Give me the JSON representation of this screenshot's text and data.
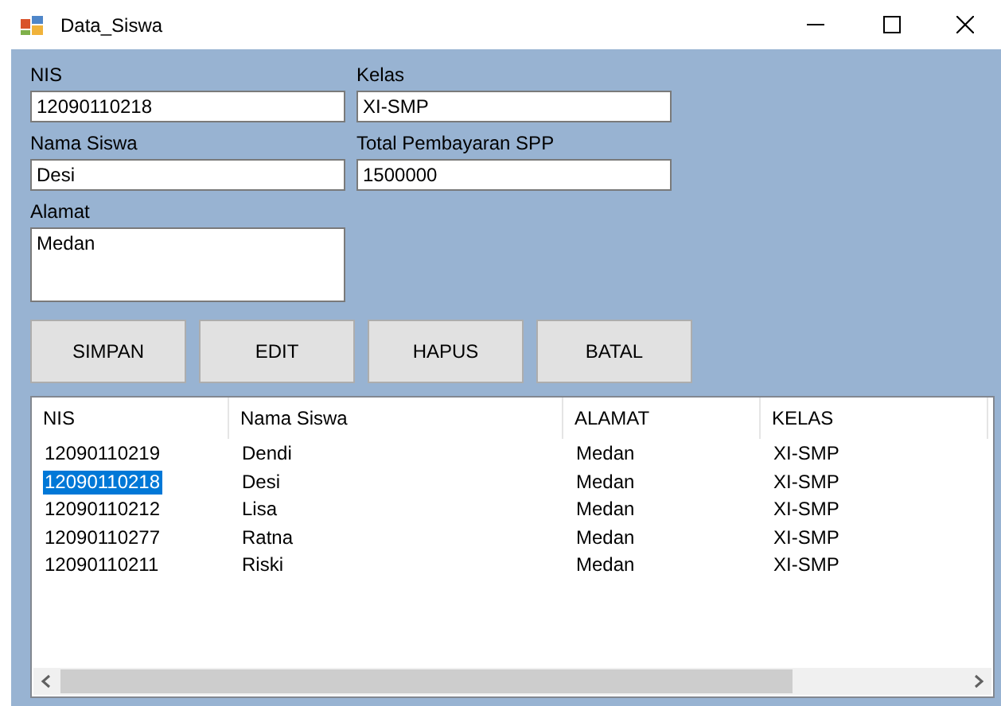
{
  "window": {
    "title": "Data_Siswa"
  },
  "fields": [
    {
      "label": "NIS",
      "value": "12090110218",
      "kind": "line"
    },
    {
      "label": "Kelas",
      "value": "XI-SMP",
      "kind": "line"
    },
    {
      "label": "Nama Siswa",
      "value": "Desi",
      "kind": "line"
    },
    {
      "label": "Total Pembayaran SPP",
      "value": "1500000",
      "kind": "line"
    },
    {
      "label": "Alamat",
      "value": "Medan",
      "kind": "multiline"
    }
  ],
  "buttons": [
    "SIMPAN",
    "EDIT",
    "HAPUS",
    "BATAL"
  ],
  "table": {
    "columns": [
      "NIS",
      "Nama Siswa",
      "ALAMAT",
      "KELAS"
    ],
    "rows": [
      {
        "cells": [
          "12090110219",
          "Dendi",
          "Medan",
          "XI-SMP"
        ],
        "selected": false
      },
      {
        "cells": [
          "12090110218",
          "Desi",
          "Medan",
          "XI-SMP"
        ],
        "selected": true
      },
      {
        "cells": [
          "12090110212",
          "Lisa",
          "Medan",
          "XI-SMP"
        ],
        "selected": false
      },
      {
        "cells": [
          "12090110277",
          "Ratna",
          "Medan",
          "XI-SMP"
        ],
        "selected": false
      },
      {
        "cells": [
          "12090110211",
          "Riski",
          "Medan",
          "XI-SMP"
        ],
        "selected": false
      }
    ]
  }
}
